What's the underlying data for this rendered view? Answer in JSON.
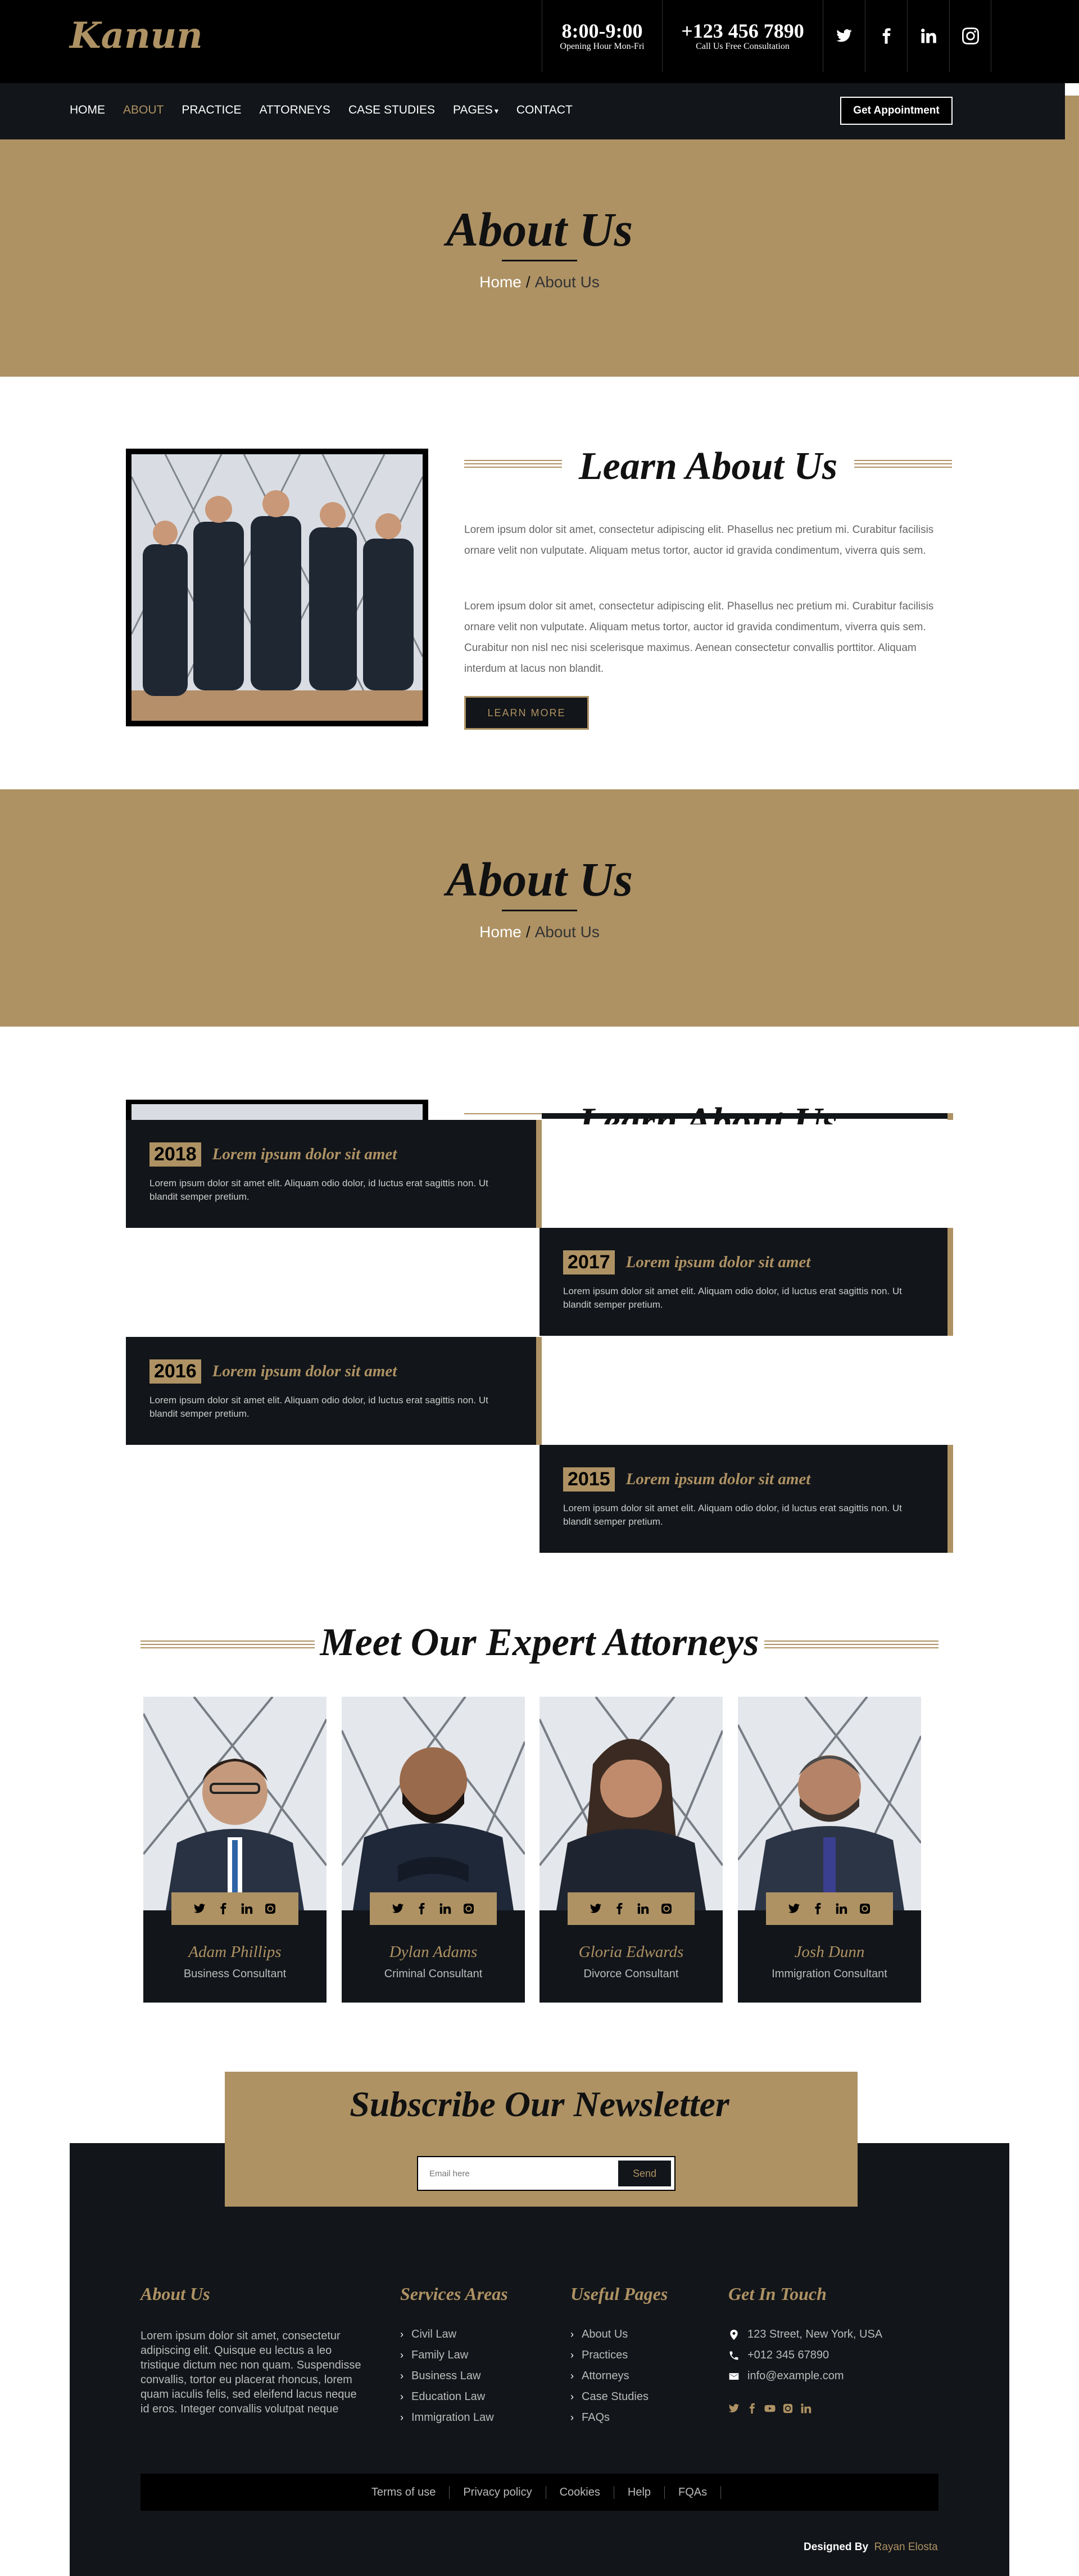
{
  "header": {
    "logo": "Kanun",
    "hours": {
      "value": "8:00-9:00",
      "label": "Opening Hour Mon-Fri"
    },
    "phone": {
      "value": "+123 456 7890",
      "label": "Call Us Free Consultation"
    },
    "social_icons": [
      "twitter-icon",
      "facebook-icon",
      "linkedin-icon",
      "instagram-icon"
    ]
  },
  "nav": {
    "items": [
      "HOME",
      "ABOUT",
      "PRACTICE",
      "ATTORNEYS",
      "CASE STUDIES",
      "PAGES",
      "CONTACT"
    ],
    "active": "ABOUT",
    "appointment": "Get Appointment"
  },
  "hero": {
    "title": "About Us",
    "breadcrumb_home": "Home",
    "breadcrumb_sep": "/",
    "breadcrumb_current": "About Us"
  },
  "about": {
    "title": "Learn About Us",
    "para1": "Lorem ipsum dolor sit amet, consectetur adipiscing elit. Phasellus nec pretium mi. Curabitur facilisis ornare velit non vulputate. Aliquam metus tortor, auctor id gravida condimentum, viverra quis sem.",
    "para2": "Lorem ipsum dolor sit amet, consectetur adipiscing elit. Phasellus nec pretium mi. Curabitur facilisis ornare velit non vulputate. Aliquam metus tortor, auctor id gravida condimentum, viverra quis sem. Curabitur non nisl nec nisi scelerisque maximus. Aenean consectetur convallis porttitor. Aliquam interdum at lacus non blandit.",
    "button": "LEARN MORE"
  },
  "timeline": [
    {
      "year": "2018",
      "title": "Lorem ipsum dolor sit amet",
      "text": "Lorem ipsum dolor sit amet elit. Aliquam odio dolor, id luctus erat sagittis non. Ut blandit semper pretium."
    },
    {
      "year": "2017",
      "title": "Lorem ipsum dolor sit amet",
      "text": "Lorem ipsum dolor sit amet elit. Aliquam odio dolor, id luctus erat sagittis non. Ut blandit semper pretium."
    },
    {
      "year": "2016",
      "title": "Lorem ipsum dolor sit amet",
      "text": "Lorem ipsum dolor sit amet elit. Aliquam odio dolor, id luctus erat sagittis non. Ut blandit semper pretium."
    },
    {
      "year": "2015",
      "title": "Lorem ipsum dolor sit amet",
      "text": "Lorem ipsum dolor sit amet elit. Aliquam odio dolor, id luctus erat sagittis non. Ut blandit semper pretium."
    }
  ],
  "team": {
    "title": "Meet Our Expert Attorneys",
    "members": [
      {
        "name": "Adam Phillips",
        "role": "Business Consultant"
      },
      {
        "name": "Dylan Adams",
        "role": "Criminal Consultant"
      },
      {
        "name": "Gloria Edwards",
        "role": "Divorce Consultant"
      },
      {
        "name": "Josh Dunn",
        "role": "Immigration Consultant"
      }
    ]
  },
  "newsletter": {
    "title": "Subscribe Our Newsletter",
    "placeholder": "Email here",
    "button": "Send"
  },
  "footer": {
    "about_title": "About Us",
    "about_text": "Lorem ipsum dolor sit amet, consectetur adipiscing elit. Quisque eu lectus a leo tristique dictum nec non quam. Suspendisse convallis, tortor eu placerat rhoncus, lorem quam iaculis felis, sed eleifend lacus neque id eros. Integer convallis volutpat neque",
    "services_title": "Services Areas",
    "services": [
      "Civil Law",
      "Family Law",
      "Business Law",
      "Education Law",
      "Immigration Law"
    ],
    "pages_title": "Useful Pages",
    "pages": [
      "About Us",
      "Practices",
      "Attorneys",
      "Case Studies",
      "FAQs"
    ],
    "contact_title": "Get In Touch",
    "address": "123 Street, New York, USA",
    "phone": "+012 345 67890",
    "email": "info@example.com",
    "bottom_links": [
      "Terms of use",
      "Privacy policy",
      "Cookies",
      "Help",
      "FQAs"
    ],
    "designed_by_label": "Designed By",
    "designed_by_name": "Rayan Elosta"
  },
  "colors": {
    "accent": "#ae9264",
    "dark": "#121519",
    "black": "#000000"
  }
}
